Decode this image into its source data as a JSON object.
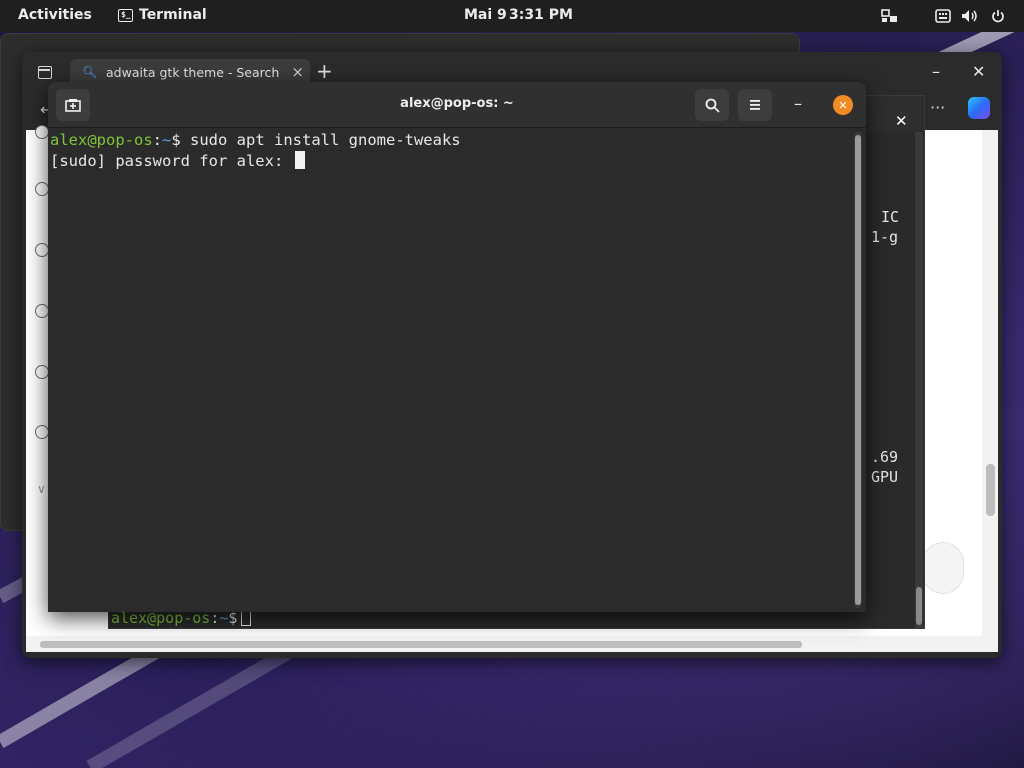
{
  "topbar": {
    "activities": "Activities",
    "app_name": "Terminal",
    "date": "Mai 9",
    "time": "3:31 PM"
  },
  "browser": {
    "tab_title": "adwaita gtk theme - Search",
    "more_icon": "···"
  },
  "terminal_back": {
    "peek_lines": [
      "IC",
      "1-g",
      ".69",
      "GPU"
    ],
    "prompt_user": "alex@pop-os",
    "prompt_sep": ":",
    "prompt_path": "~",
    "prompt_sym": "$"
  },
  "terminal": {
    "title": "alex@pop-os: ~",
    "prompt_user": "alex@pop-os",
    "prompt_sep": ":",
    "prompt_path": "~",
    "prompt_sym": "$ ",
    "command": "sudo apt install gnome-tweaks",
    "sudo_prompt": "[sudo] password for alex: "
  },
  "colors": {
    "prompt_user": "#7ec53a",
    "prompt_path": "#5aa0e6",
    "close_button": "#f28b24"
  }
}
